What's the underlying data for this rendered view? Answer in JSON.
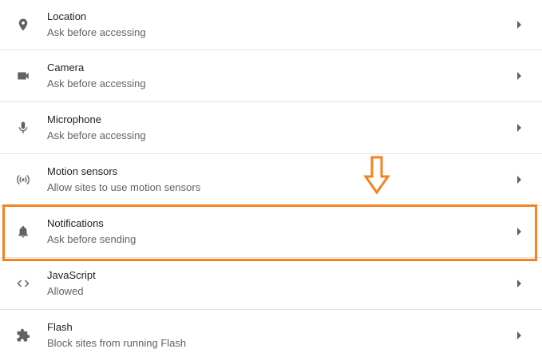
{
  "settings": {
    "items": [
      {
        "icon": "location-pin-icon",
        "title": "Location",
        "subtitle": "Ask before accessing"
      },
      {
        "icon": "camera-icon",
        "title": "Camera",
        "subtitle": "Ask before accessing"
      },
      {
        "icon": "microphone-icon",
        "title": "Microphone",
        "subtitle": "Ask before accessing"
      },
      {
        "icon": "motion-sensors-icon",
        "title": "Motion sensors",
        "subtitle": "Allow sites to use motion sensors"
      },
      {
        "icon": "bell-icon",
        "title": "Notifications",
        "subtitle": "Ask before sending"
      },
      {
        "icon": "code-brackets-icon",
        "title": "JavaScript",
        "subtitle": "Allowed"
      },
      {
        "icon": "puzzle-piece-icon",
        "title": "Flash",
        "subtitle": "Block sites from running Flash"
      }
    ]
  },
  "annotation": {
    "highlight_color": "#f5821f",
    "highlighted_item": "Notifications"
  },
  "colors": {
    "icon": "#5f6368",
    "title": "#202124",
    "subtitle": "#5f6368",
    "divider": "#e3e3e3"
  }
}
